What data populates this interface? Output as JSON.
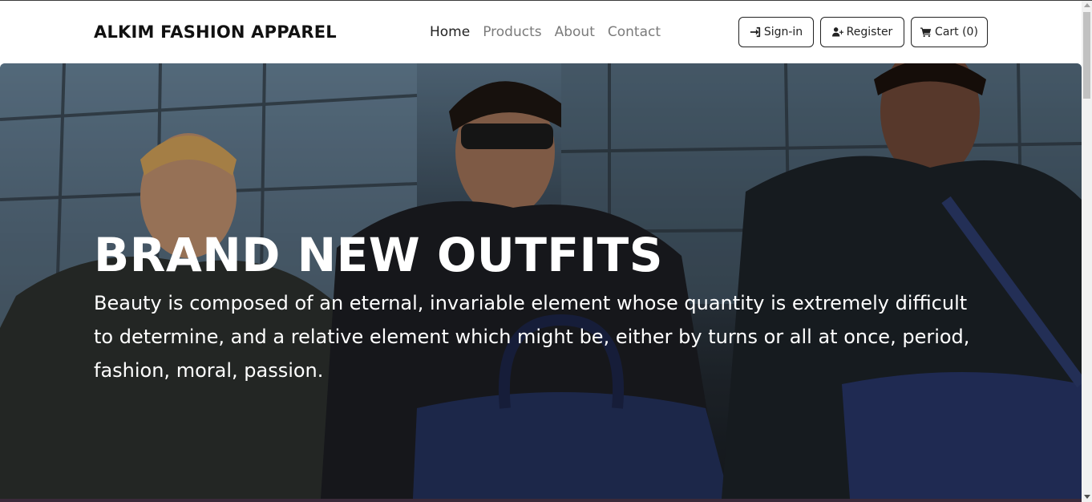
{
  "navbar": {
    "brand": "ALKIM FASHION APPAREL",
    "links": [
      {
        "label": "Home",
        "active": true
      },
      {
        "label": "Products",
        "active": false
      },
      {
        "label": "About",
        "active": false
      },
      {
        "label": "Contact",
        "active": false
      }
    ],
    "buttons": {
      "signin": {
        "label": "Sign-in",
        "icon": "sign-in-icon"
      },
      "register": {
        "label": "Register",
        "icon": "user-plus-icon"
      },
      "cart": {
        "label": "Cart (0)",
        "icon": "cart-icon"
      }
    }
  },
  "hero": {
    "title": "BRAND NEW OUTFITS",
    "text": "Beauty is composed of an eternal, invariable element whose quantity is extremely difficult to determine, and a relative element which might be, either by turns or all at once, period, fashion, moral, passion.",
    "image": "three-models-with-navy-leather-bags"
  }
}
